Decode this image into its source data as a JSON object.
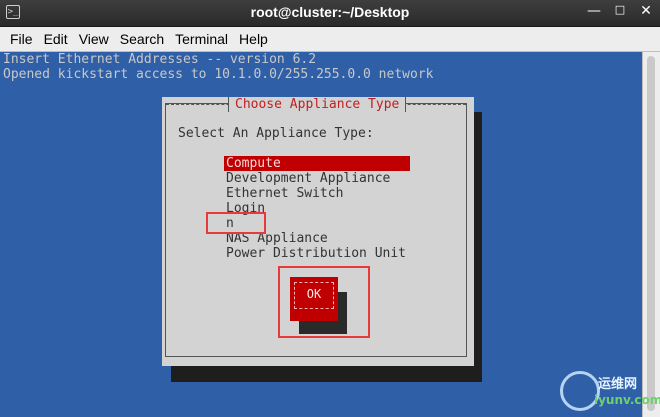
{
  "window": {
    "title": "root@cluster:~/Desktop",
    "icon": "terminal-icon",
    "controls": [
      "minimize-icon",
      "maximize-icon",
      "close-icon"
    ]
  },
  "menubar": {
    "items": [
      "File",
      "Edit",
      "View",
      "Search",
      "Terminal",
      "Help"
    ]
  },
  "terminal": {
    "lines": [
      "Insert Ethernet Addresses -- version 6.2",
      "Opened kickstart access to 10.1.0.0/255.255.0.0 network"
    ]
  },
  "dialog": {
    "title": "Choose Appliance Type",
    "prompt": "Select An Appliance Type:",
    "options": [
      "Compute",
      "Development Appliance",
      "Ethernet Switch",
      "Login",
      "n",
      "NAS Appliance",
      "Power Distribution Unit"
    ],
    "selected_index": 0,
    "ok_label": "OK"
  },
  "watermark": {
    "line1": "运维网",
    "line2": "iyunv.com"
  },
  "colors": {
    "terminal_bg": "#2f5fa7",
    "dialog_bg": "#d3d3d3",
    "accent_red": "#c00000",
    "annotation_red": "#e83a3a"
  }
}
